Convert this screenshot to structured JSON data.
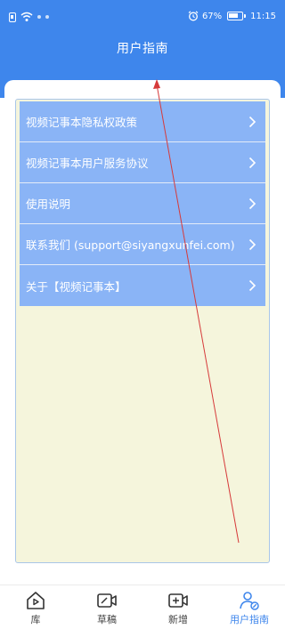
{
  "status_bar": {
    "battery_percent": "67%",
    "time": "11:15"
  },
  "header": {
    "title": "用户指南",
    "background_color": "#3e86ec"
  },
  "menu": {
    "items": [
      {
        "label": "视频记事本隐私权政策",
        "icon": "chevron-right-icon"
      },
      {
        "label": "视频记事本用户服务协议",
        "icon": "chevron-right-icon"
      },
      {
        "label": "使用说明",
        "icon": "chevron-right-icon"
      },
      {
        "label": "联系我们 (support@siyangxunfei.com)",
        "icon": "chevron-right-icon"
      },
      {
        "label": "关于【视频记事本】",
        "icon": "chevron-right-icon"
      }
    ],
    "item_color": "#8ab4f6",
    "panel_color": "#f5f5dc"
  },
  "bottom_nav": {
    "items": [
      {
        "label": "库",
        "icon": "library-icon",
        "active": false
      },
      {
        "label": "草稿",
        "icon": "drafts-icon",
        "active": false
      },
      {
        "label": "新增",
        "icon": "add-video-icon",
        "active": false
      },
      {
        "label": "用户指南",
        "icon": "user-guide-icon",
        "active": true
      }
    ],
    "active_color": "#3e86ec"
  }
}
